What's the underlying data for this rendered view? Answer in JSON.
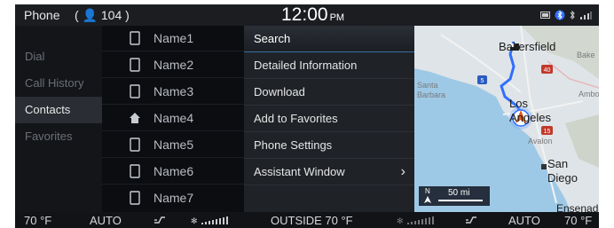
{
  "status_bar": {
    "app_title": "Phone",
    "contact_count": "( 👤 104 )",
    "clock": "12:00",
    "ampm": "PM",
    "icons": [
      "battery-icon",
      "bluetooth-icon",
      "bluetooth-phone-icon",
      "signal-icon"
    ]
  },
  "left_menu": {
    "items": [
      {
        "label": "Dial",
        "selected": false
      },
      {
        "label": "Call History",
        "selected": false
      },
      {
        "label": "Contacts",
        "selected": true
      },
      {
        "label": "Favorites",
        "selected": false
      }
    ]
  },
  "contacts": {
    "rows": [
      {
        "name": "Name1",
        "icon": "phone-icon"
      },
      {
        "name": "Name2",
        "icon": "phone-icon"
      },
      {
        "name": "Name3",
        "icon": "phone-icon"
      },
      {
        "name": "Name4",
        "icon": "home-icon"
      },
      {
        "name": "Name5",
        "icon": "phone-icon"
      },
      {
        "name": "Name6",
        "icon": "phone-icon"
      },
      {
        "name": "Name7",
        "icon": "phone-icon"
      }
    ]
  },
  "popup_menu": {
    "items": [
      {
        "label": "Search",
        "highlight": true,
        "has_submenu": false
      },
      {
        "label": "Detailed Information",
        "highlight": false,
        "has_submenu": false
      },
      {
        "label": "Download",
        "highlight": false,
        "has_submenu": false
      },
      {
        "label": "Add to Favorites",
        "highlight": false,
        "has_submenu": false
      },
      {
        "label": "Phone Settings",
        "highlight": false,
        "has_submenu": false
      },
      {
        "label": "Assistant Window",
        "highlight": false,
        "has_submenu": true
      }
    ],
    "chevron": "›"
  },
  "map": {
    "cities": [
      "Bakersfield",
      "Los Angeles",
      "San Diego",
      "Ensenada"
    ],
    "small_labels": [
      "Bake",
      "Ambo",
      "Santa",
      "Barbara",
      "Avalon"
    ],
    "highway_shields": [
      "5",
      "40",
      "15"
    ],
    "scale": {
      "north": "N",
      "distance": "50 mi"
    },
    "colors": {
      "route": "#2f6fff",
      "land": "#dfe4e8",
      "water": "#9ec9e6"
    }
  },
  "climate_bar": {
    "left_temp": "70 °F",
    "left_mode": "AUTO",
    "outside": "OUTSIDE  70 °F",
    "right_mode": "AUTO",
    "right_temp": "70 °F"
  }
}
